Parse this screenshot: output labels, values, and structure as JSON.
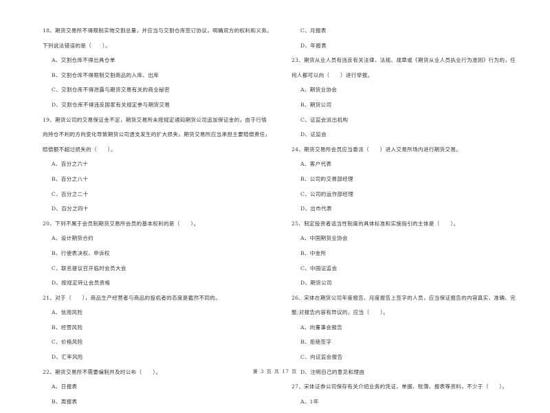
{
  "left_column": [
    {
      "type": "q",
      "text": "18、期货交易所不得限制实物交割总量，并应当与交割仓库签订协议，明确双方的权利和义务。"
    },
    {
      "type": "q",
      "text": "下列说法错误的是（　　）。"
    },
    {
      "type": "opt",
      "text": "A、交割仓库不得出具仓单"
    },
    {
      "type": "opt",
      "text": "B、交割仓库不得限制交割商品的入库、出库"
    },
    {
      "type": "opt",
      "text": "C、交割仓库不得泄露与期货交易有关的商业秘密"
    },
    {
      "type": "opt",
      "text": "D、交割仓库不得违反国家有关规定参与期货交易"
    },
    {
      "type": "q",
      "text": "19、期货公司的交易保证金不足，期货交易所未按规定通知期货公司追加保证金的，由于行情"
    },
    {
      "type": "q",
      "text": "向持仓不利的方向变化导致期货公司透支发生的扩大损失，期货交易所应当承担主要赔偿责任，"
    },
    {
      "type": "q",
      "text": "赔偿额不超过损失的（　　）。"
    },
    {
      "type": "opt",
      "text": "A、百分之六十"
    },
    {
      "type": "opt",
      "text": "B、百分之八十"
    },
    {
      "type": "opt",
      "text": "C、百分之二十"
    },
    {
      "type": "opt",
      "text": "D、百分之四十"
    },
    {
      "type": "q",
      "text": "20、下列不属于会员制期货交易所会员的基本权利的是（　　）。"
    },
    {
      "type": "opt",
      "text": "A、设计期货合约"
    },
    {
      "type": "opt",
      "text": "B、行使表决权、申诉权"
    },
    {
      "type": "opt",
      "text": "C、联名提议召开临时会员大会"
    },
    {
      "type": "opt",
      "text": "D、按规定转让会员资格"
    },
    {
      "type": "q",
      "text": "21、对于（　　），商品生产经营者与商品的投机者的态度是截然不同的。"
    },
    {
      "type": "opt",
      "text": "A、信用风险"
    },
    {
      "type": "opt",
      "text": "B、经营风险"
    },
    {
      "type": "opt",
      "text": "C、价格风险"
    },
    {
      "type": "opt",
      "text": "D、汇率风险"
    },
    {
      "type": "q",
      "text": "22、期货交易所不需要编制并及时公布（　　）。"
    },
    {
      "type": "opt",
      "text": "A、日报表"
    },
    {
      "type": "opt",
      "text": "B、周报表"
    }
  ],
  "right_column": [
    {
      "type": "opt",
      "text": "C、月报表"
    },
    {
      "type": "opt",
      "text": "D、年报表"
    },
    {
      "type": "q",
      "text": "23、期货从业人员有违反有关法律、法规、规章或《期货从业人员执业行为准则》行为的，任"
    },
    {
      "type": "q",
      "text": "何人都可以向（　　）进行举报。"
    },
    {
      "type": "opt",
      "text": "A、期货业协会"
    },
    {
      "type": "opt",
      "text": "B、期货公司"
    },
    {
      "type": "opt",
      "text": "C、证监会派出机构"
    },
    {
      "type": "opt",
      "text": "D、证监会"
    },
    {
      "type": "q",
      "text": "24、期货交易所会员应当委派（　　）进入交易所场内进行期货交易。"
    },
    {
      "type": "opt",
      "text": "A、客户代表"
    },
    {
      "type": "opt",
      "text": "B、公司的交易部经理"
    },
    {
      "type": "opt",
      "text": "C、公司的运作部经理"
    },
    {
      "type": "opt",
      "text": "D、出市代表"
    },
    {
      "type": "q",
      "text": "25、制定投资者适当性制度的具体标准和实施指引的主体是（　　）。"
    },
    {
      "type": "opt",
      "text": "A、中国期货业协会"
    },
    {
      "type": "opt",
      "text": "B、中金所"
    },
    {
      "type": "opt",
      "text": "C、中国证监会"
    },
    {
      "type": "opt",
      "text": "D、期货公司"
    },
    {
      "type": "q",
      "text": "26、宋体在期货公司年度报告、月度报告上签字的人员，应当保证报告的内容真实、准确、完"
    },
    {
      "type": "q",
      "text": "整;对报告内容有异议的，应当（　　）。"
    },
    {
      "type": "opt",
      "text": "A、向董事会报告"
    },
    {
      "type": "opt",
      "text": "B、拒绝签字"
    },
    {
      "type": "opt",
      "text": "C、向证监会报告"
    },
    {
      "type": "opt",
      "text": "D、注明自己的意见和理由"
    },
    {
      "type": "q",
      "text": "27、宋体证券公司保存有关介绍业务的凭证、单据、账簿、报表等资料，不少于（　　）。"
    },
    {
      "type": "opt",
      "text": "A、1年"
    }
  ],
  "footer": {
    "page_label": "第 3 页 共 17 页"
  }
}
